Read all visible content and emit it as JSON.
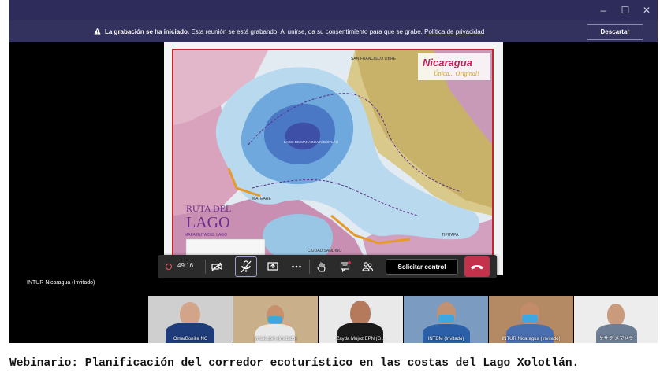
{
  "window": {
    "controls": [
      "–",
      "☐",
      "✕"
    ]
  },
  "recording_banner": {
    "title": "La grabación se ha iniciado.",
    "message": " Esta reunión se está grabando. Al unirse, da su consentimiento para que se grabe. ",
    "link": "Política de privacidad",
    "dismiss_label": "Descartar"
  },
  "slide": {
    "logo_text": "Nicaragua",
    "logo_sub": "Única... Original!",
    "top_label": "SAN FRANCISCO LIBRE",
    "lake_label": "LAGO DE MANAGUA XOLOTLÁN",
    "ruta_line1": "RUTA DEL",
    "ruta_line2": "LAGO",
    "map_subtitle": "MAPA RUTA DEL LAGO",
    "city_label": "CIUDAD SANDINO",
    "town_right": "TIPITAPA",
    "town_left": "MATEARE"
  },
  "presenter_label": "INTUR Nicaragua (Invitado)",
  "call_controls": {
    "elapsed": "49:16",
    "request_control_label": "Solicitar control"
  },
  "participants": [
    {
      "name": "OmarBonilla NC",
      "bg": "#cfcfcf",
      "shirt": "#1f3c7a",
      "mask": ""
    },
    {
      "name": "ymalespin (Invitado)",
      "bg": "#c9b08a",
      "shirt": "#e8e8e8",
      "mask": "#3fa6e0"
    },
    {
      "name": "Zayda Mujoz EPN (G...",
      "bg": "#e9e9e9",
      "shirt": "#1b1b1b",
      "mask": ""
    },
    {
      "name": "INTDM (Invitado)",
      "bg": "#7b9cc0",
      "shirt": "#2b5fa8",
      "mask": "#3fa6e0"
    },
    {
      "name": "INTUR Nicaragua (Invitado)",
      "bg": "#b48a64",
      "shirt": "#4a6fb0",
      "mask": "#3fa6e0"
    },
    {
      "name": "ケサラ メマメラ",
      "bg": "#ededed",
      "shirt": "#6d7d93",
      "mask": ""
    }
  ],
  "caption": "Webinario: Planificación del corredor ecoturístico en las costas del Lago Xolotlán."
}
